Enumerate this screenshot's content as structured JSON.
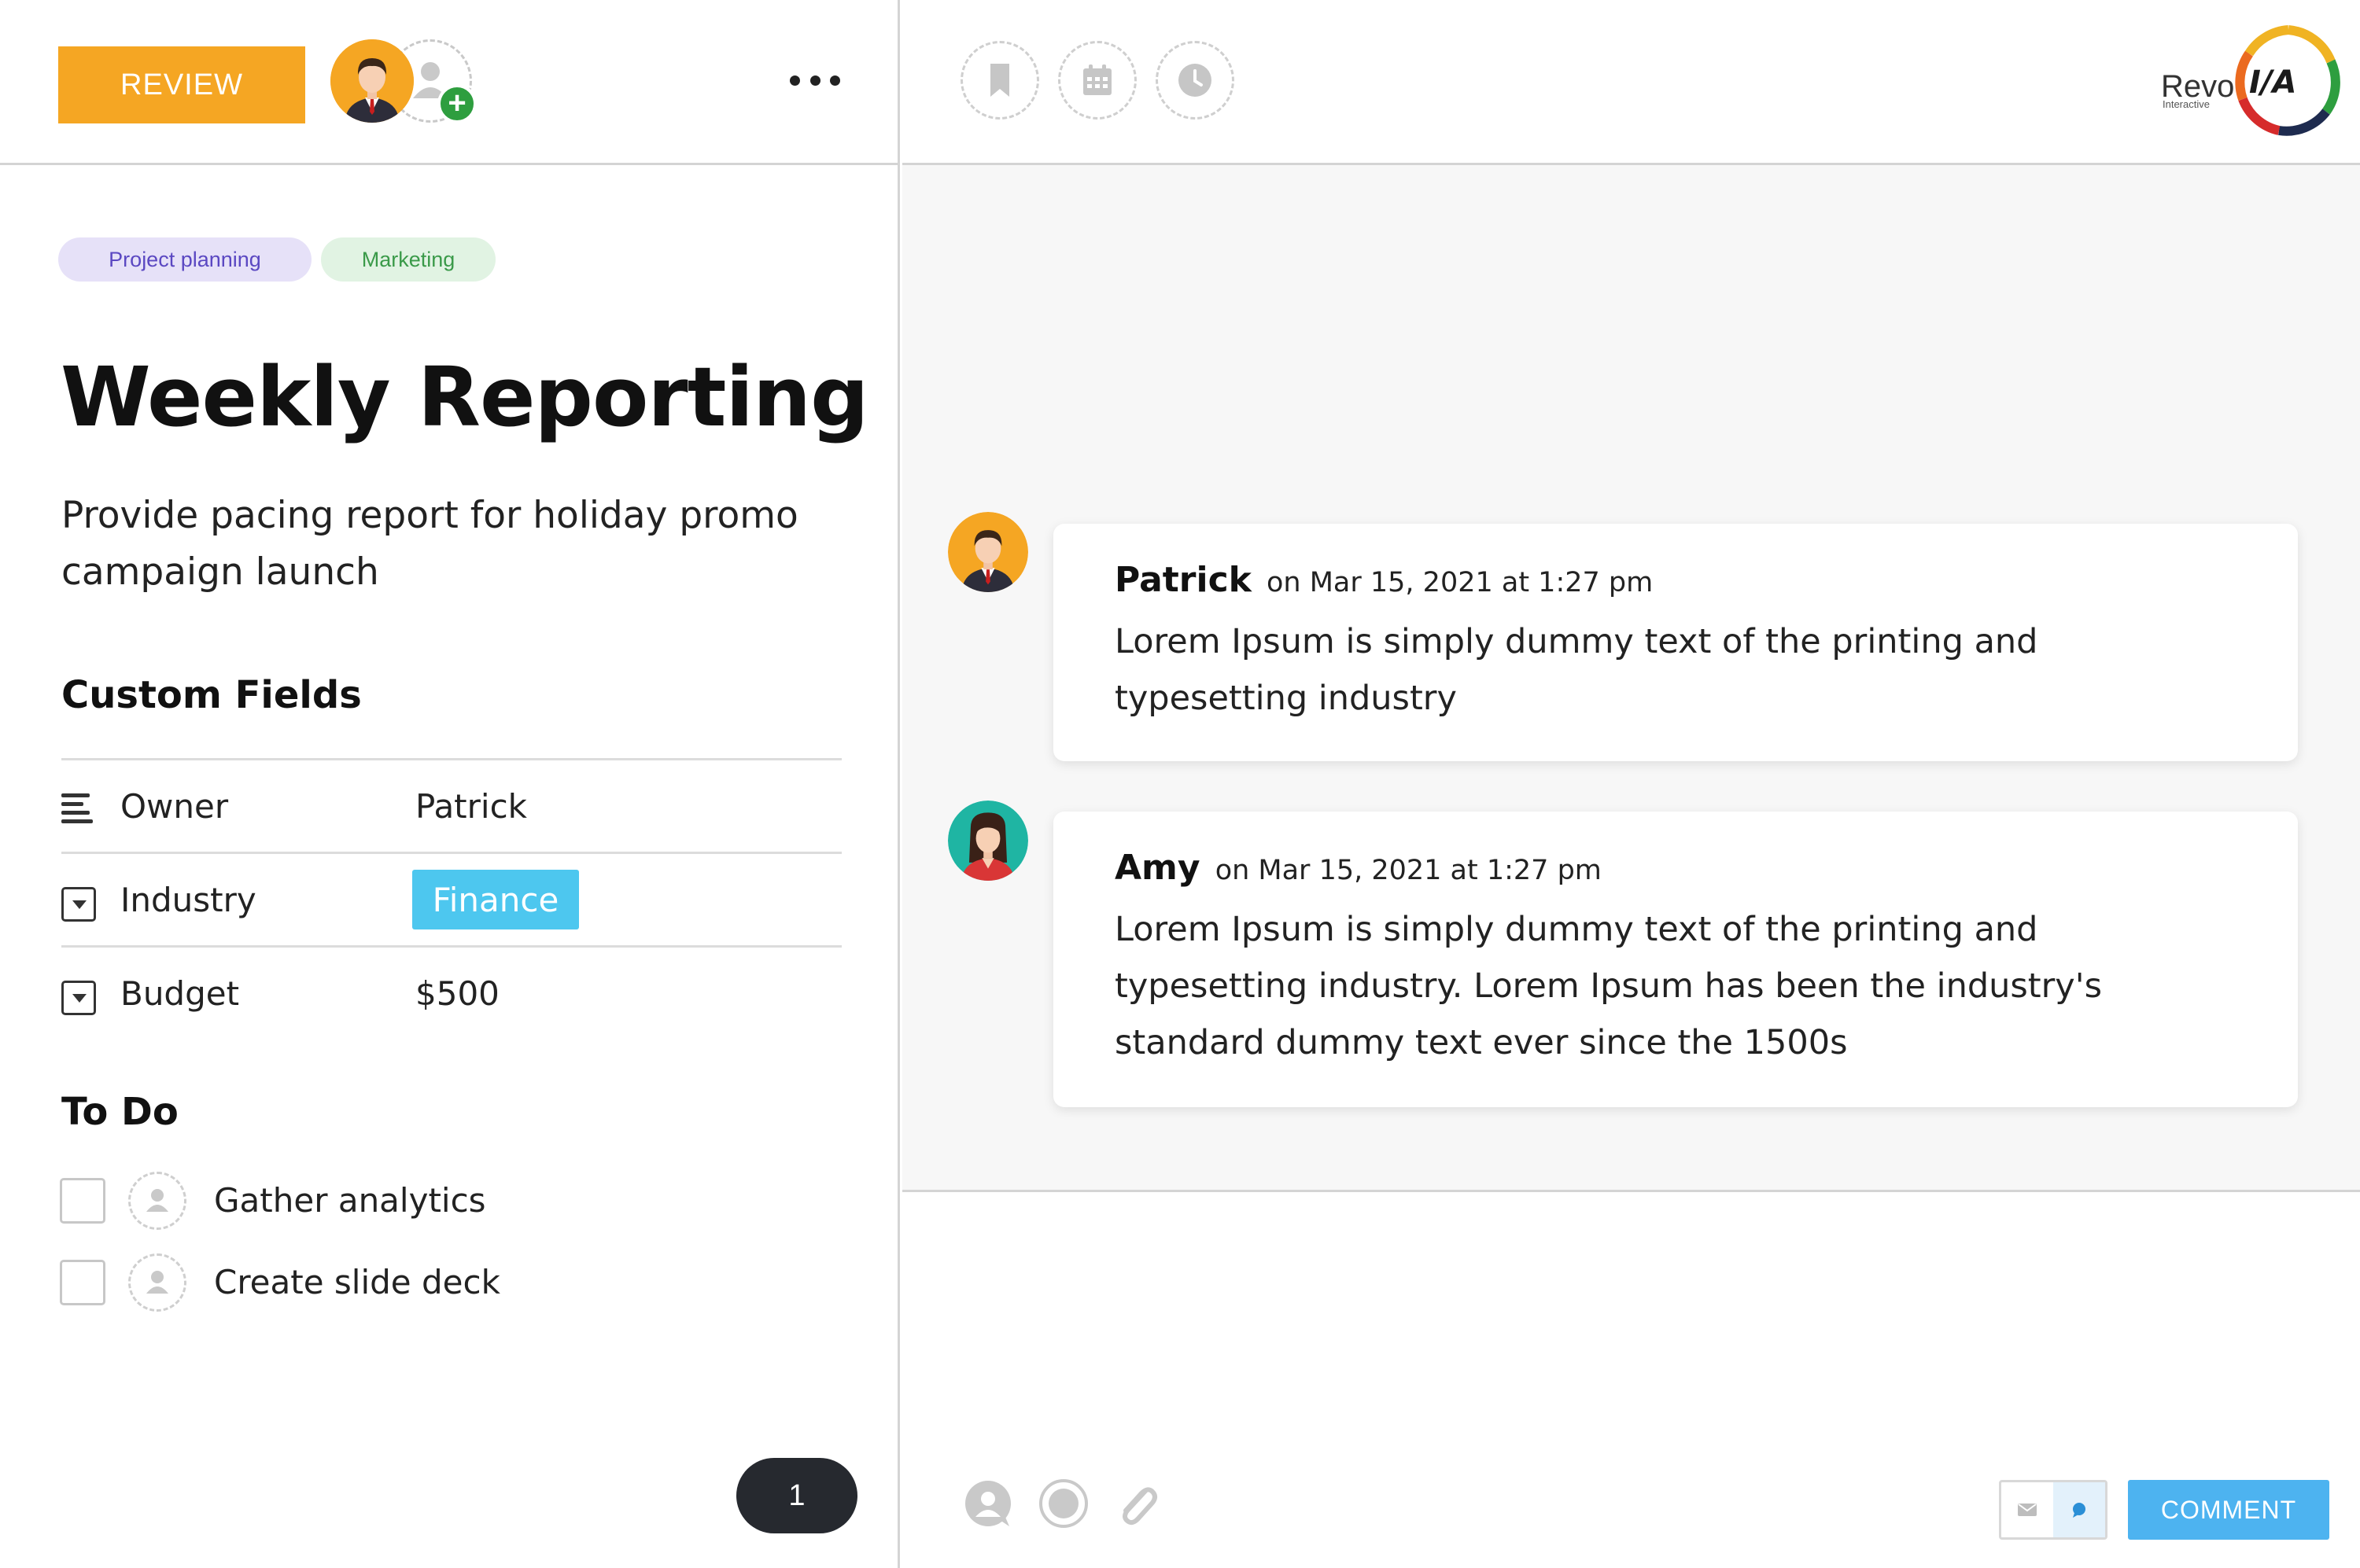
{
  "left_header": {
    "review_label": "REVIEW",
    "owner_avatar": "businessman-avatar",
    "add_member_icon": "add-user-icon",
    "more_icon": "more-horizontal-icon"
  },
  "tags": [
    {
      "label": "Project planning",
      "color": "#5b48c2",
      "bg": "#e6e1f8"
    },
    {
      "label": "Marketing",
      "color": "#3a9a49",
      "bg": "#e1f3e3"
    }
  ],
  "task": {
    "title": "Weekly Reporting",
    "description": "Provide pacing report for holiday promo campaign launch"
  },
  "custom_fields": {
    "title": "Custom Fields",
    "rows": [
      {
        "icon": "text-lines-icon",
        "label": "Owner",
        "value": "Patrick"
      },
      {
        "icon": "dropdown-icon",
        "label": "Industry",
        "value": "Finance",
        "badge_color": "#4dc7ef"
      },
      {
        "icon": "dropdown-icon",
        "label": "Budget",
        "value": "$500"
      }
    ]
  },
  "todo": {
    "title": "To Do",
    "items": [
      {
        "text": "Gather analytics",
        "checked": false
      },
      {
        "text": "Create slide deck",
        "checked": false
      }
    ]
  },
  "pagination": {
    "current": "1"
  },
  "right_header": {
    "tools": [
      "bookmark-icon",
      "calendar-icon",
      "clock-icon"
    ],
    "logo_text": "Revo",
    "logo_subtext": "Interactive",
    "logo_mark": "I/A"
  },
  "comments": [
    {
      "author": "Patrick",
      "date": "on Mar 15, 2021 at 1:27 pm",
      "lines": [
        "Lorem Ipsum is simply dummy text of the printing and",
        "typesetting industry"
      ]
    },
    {
      "author": "Amy",
      "date": "on Mar 15, 2021 at 1:27 pm",
      "lines": [
        "Lorem Ipsum is simply dummy text of the printing and",
        "typesetting industry. Lorem Ipsum has been the industry's",
        "standard dummy text ever since the 1500s"
      ]
    }
  ],
  "composer": {
    "tools": [
      "mention-icon",
      "record-icon",
      "attachment-icon"
    ],
    "modes": [
      "email-icon",
      "chat-icon"
    ],
    "submit_label": "COMMENT"
  },
  "colors": {
    "accent_orange": "#f5a623",
    "accent_blue": "#4db3f0",
    "finance_badge": "#4dc7ef",
    "add_green": "#2e9e3f"
  }
}
